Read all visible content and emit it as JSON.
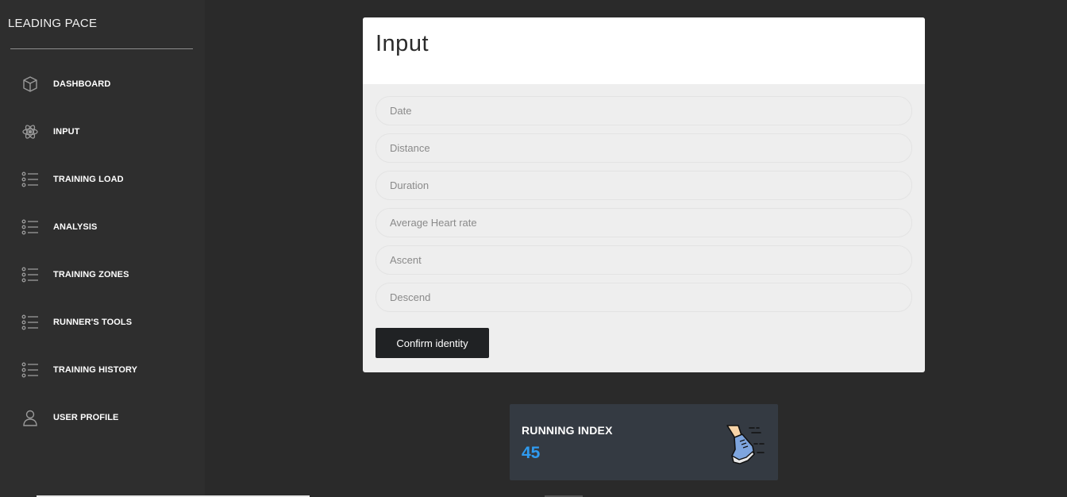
{
  "sidebar": {
    "brand": "LEADING PACE",
    "items": [
      {
        "label": "DASHBOARD",
        "icon": "cube-icon"
      },
      {
        "label": "INPUT",
        "icon": "atom-icon"
      },
      {
        "label": "TRAINING LOAD",
        "icon": "list-icon"
      },
      {
        "label": "ANALYSIS",
        "icon": "list-icon"
      },
      {
        "label": "TRAINING ZONES",
        "icon": "list-icon"
      },
      {
        "label": "RUNNER'S TOOLS",
        "icon": "list-icon"
      },
      {
        "label": "TRAINING HISTORY",
        "icon": "list-icon"
      },
      {
        "label": "USER PROFILE",
        "icon": "user-icon"
      }
    ]
  },
  "form": {
    "title": "Input",
    "fields": [
      {
        "placeholder": "Date",
        "value": ""
      },
      {
        "placeholder": "Distance",
        "value": ""
      },
      {
        "placeholder": "Duration",
        "value": ""
      },
      {
        "placeholder": "Average Heart rate",
        "value": ""
      },
      {
        "placeholder": "Ascent",
        "value": ""
      },
      {
        "placeholder": "Descend",
        "value": ""
      }
    ],
    "submit_label": "Confirm identity"
  },
  "stat": {
    "label": "RUNNING INDEX",
    "value": "45",
    "icon": "running-shoe-icon",
    "value_color": "#2f9bf0"
  }
}
